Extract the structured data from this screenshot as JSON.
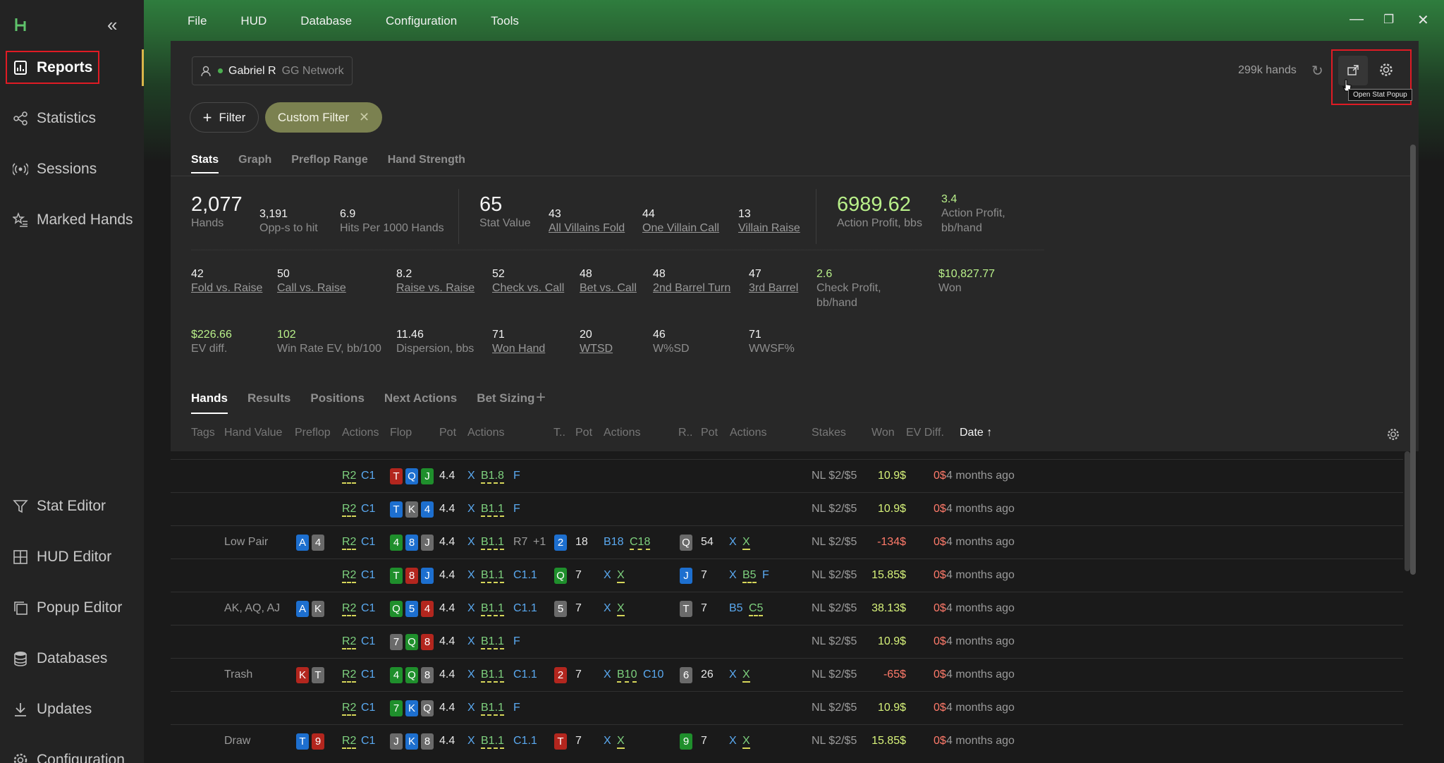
{
  "sidebar": {
    "items": [
      {
        "label": "Reports",
        "icon": "bar-chart-icon",
        "active": true
      },
      {
        "label": "Statistics",
        "icon": "share-nodes-icon"
      },
      {
        "label": "Sessions",
        "icon": "broadcast-icon"
      },
      {
        "label": "Marked Hands",
        "icon": "star-list-icon"
      },
      {
        "label": "Stat Editor",
        "icon": "funnel-icon"
      },
      {
        "label": "HUD Editor",
        "icon": "grid-add-icon"
      },
      {
        "label": "Popup Editor",
        "icon": "copy-icon"
      },
      {
        "label": "Databases",
        "icon": "database-icon"
      },
      {
        "label": "Updates",
        "icon": "download-icon"
      },
      {
        "label": "Configuration",
        "icon": "gear-icon"
      }
    ]
  },
  "menu": [
    "File",
    "HUD",
    "Database",
    "Configuration",
    "Tools"
  ],
  "header": {
    "player": "Gabriel R",
    "network": "GG Network",
    "hands_count": "299k hands",
    "tooltip": "Open Stat Popup"
  },
  "filters": {
    "filter_label": "Filter",
    "custom_label": "Custom Filter"
  },
  "stat_tabs": [
    "Stats",
    "Graph",
    "Preflop Range",
    "Hand Strength"
  ],
  "stats": {
    "hands": {
      "v": "2,077",
      "l": "Hands"
    },
    "opps": {
      "v": "3,191",
      "l": "Opp-s to hit"
    },
    "hits": {
      "v": "6.9",
      "l": "Hits Per 1000 Hands"
    },
    "stat_value": {
      "v": "65",
      "l": "Stat Value"
    },
    "all_fold": {
      "v": "43",
      "l": "All Villains Fold"
    },
    "one_call": {
      "v": "44",
      "l": "One Villain Call"
    },
    "v_raise": {
      "v": "13",
      "l": "Villain Raise"
    },
    "action_profit": {
      "v": "6989.62",
      "l": "Action Profit, bbs"
    },
    "action_profit_hand": {
      "v": "3.4",
      "l1": "Action Profit,",
      "l2": "bb/hand"
    },
    "fold_raise": {
      "v": "42",
      "l": "Fold vs. Raise"
    },
    "call_raise": {
      "v": "50",
      "l": "Call vs. Raise"
    },
    "raise_raise": {
      "v": "8.2",
      "l": "Raise vs. Raise"
    },
    "check_call": {
      "v": "52",
      "l": "Check vs. Call"
    },
    "bet_call": {
      "v": "48",
      "l": "Bet vs. Call"
    },
    "barrel2": {
      "v": "48",
      "l": "2nd Barrel Turn"
    },
    "barrel3": {
      "v": "47",
      "l": "3rd Barrel"
    },
    "check_profit": {
      "v": "2.6",
      "l1": "Check Profit,",
      "l2": "bb/hand"
    },
    "won": {
      "v": "$10,827.77",
      "l": "Won"
    },
    "ev_diff": {
      "v": "$226.66",
      "l": "EV diff."
    },
    "win_rate": {
      "v": "102",
      "l": "Win Rate EV, bb/100"
    },
    "dispersion": {
      "v": "11.46",
      "l": "Dispersion, bbs"
    },
    "won_hand": {
      "v": "71",
      "l": "Won Hand"
    },
    "wtsd": {
      "v": "20",
      "l": "WTSD"
    },
    "wsd": {
      "v": "46",
      "l": "W%SD"
    },
    "wwsf": {
      "v": "71",
      "l": "WWSF%"
    }
  },
  "hand_tabs": [
    "Hands",
    "Results",
    "Positions",
    "Next Actions",
    "Bet Sizing"
  ],
  "columns": [
    "Tags",
    "Hand Value",
    "Preflop",
    "Actions",
    "Flop",
    "Pot",
    "Actions",
    "T..",
    "Pot",
    "Actions",
    "R..",
    "Pot",
    "Actions",
    "Stakes",
    "Won",
    "EV Diff.",
    "Date ↑"
  ],
  "rows": [
    {
      "hv": "",
      "hole": [],
      "pre": [
        "R2",
        "C1"
      ],
      "flop": [
        [
          "T",
          "r"
        ],
        [
          "Q",
          "b"
        ],
        [
          "J",
          "g"
        ]
      ],
      "fpot": "4.4",
      "fact": [
        "X",
        "B1.8",
        "F"
      ],
      "turn": null,
      "tpot": "",
      "tact": [],
      "river": null,
      "rpot": "",
      "ract": [],
      "stakes": "NL $2/$5",
      "won": "10.9$",
      "ev": "0$",
      "date": "4 months ago"
    },
    {
      "hv": "",
      "hole": [],
      "pre": [
        "R2",
        "C1"
      ],
      "flop": [
        [
          "T",
          "b"
        ],
        [
          "K",
          "x"
        ],
        [
          "4",
          "b"
        ]
      ],
      "fpot": "4.4",
      "fact": [
        "X",
        "B1.1",
        "F"
      ],
      "turn": null,
      "tpot": "",
      "tact": [],
      "river": null,
      "rpot": "",
      "ract": [],
      "stakes": "NL $2/$5",
      "won": "10.9$",
      "ev": "0$",
      "date": "4 months ago"
    },
    {
      "hv": "Low Pair",
      "hole": [
        [
          "A",
          "b"
        ],
        [
          "4",
          "x"
        ]
      ],
      "pre": [
        "R2",
        "C1"
      ],
      "flop": [
        [
          "4",
          "g"
        ],
        [
          "8",
          "b"
        ],
        [
          "J",
          "x"
        ]
      ],
      "fpot": "4.4",
      "fact": [
        "X",
        "B1.1",
        "R7",
        "+1"
      ],
      "turn": [
        "2",
        "b"
      ],
      "tpot": "18",
      "tact": [
        "B18",
        "C18"
      ],
      "river": [
        "Q",
        "x"
      ],
      "rpot": "54",
      "ract": [
        "X",
        "X"
      ],
      "stakes": "NL $2/$5",
      "won": "-134$",
      "ev": "0$",
      "date": "4 months ago"
    },
    {
      "hv": "",
      "hole": [],
      "pre": [
        "R2",
        "C1"
      ],
      "flop": [
        [
          "T",
          "g"
        ],
        [
          "8",
          "r"
        ],
        [
          "J",
          "b"
        ]
      ],
      "fpot": "4.4",
      "fact": [
        "X",
        "B1.1",
        "C1.1"
      ],
      "turn": [
        "Q",
        "g"
      ],
      "tpot": "7",
      "tact": [
        "X",
        "X"
      ],
      "river": [
        "J",
        "b"
      ],
      "rpot": "7",
      "ract": [
        "X",
        "B5",
        "F"
      ],
      "stakes": "NL $2/$5",
      "won": "15.85$",
      "ev": "0$",
      "date": "4 months ago"
    },
    {
      "hv": "AK, AQ, AJ",
      "hole": [
        [
          "A",
          "b"
        ],
        [
          "K",
          "x"
        ]
      ],
      "pre": [
        "R2",
        "C1"
      ],
      "flop": [
        [
          "Q",
          "g"
        ],
        [
          "5",
          "b"
        ],
        [
          "4",
          "r"
        ]
      ],
      "fpot": "4.4",
      "fact": [
        "X",
        "B1.1",
        "C1.1"
      ],
      "turn": [
        "5",
        "x"
      ],
      "tpot": "7",
      "tact": [
        "X",
        "X"
      ],
      "river": [
        "T",
        "x"
      ],
      "rpot": "7",
      "ract": [
        "B5",
        "C5"
      ],
      "stakes": "NL $2/$5",
      "won": "38.13$",
      "ev": "0$",
      "date": "4 months ago"
    },
    {
      "hv": "",
      "hole": [],
      "pre": [
        "R2",
        "C1"
      ],
      "flop": [
        [
          "7",
          "x"
        ],
        [
          "Q",
          "g"
        ],
        [
          "8",
          "r"
        ]
      ],
      "fpot": "4.4",
      "fact": [
        "X",
        "B1.1",
        "F"
      ],
      "turn": null,
      "tpot": "",
      "tact": [],
      "river": null,
      "rpot": "",
      "ract": [],
      "stakes": "NL $2/$5",
      "won": "10.9$",
      "ev": "0$",
      "date": "4 months ago"
    },
    {
      "hv": "Trash",
      "hole": [
        [
          "K",
          "r"
        ],
        [
          "T",
          "x"
        ]
      ],
      "pre": [
        "R2",
        "C1"
      ],
      "flop": [
        [
          "4",
          "g"
        ],
        [
          "Q",
          "g"
        ],
        [
          "8",
          "x"
        ]
      ],
      "fpot": "4.4",
      "fact": [
        "X",
        "B1.1",
        "C1.1"
      ],
      "turn": [
        "2",
        "r"
      ],
      "tpot": "7",
      "tact": [
        "X",
        "B10",
        "C10"
      ],
      "river": [
        "6",
        "x"
      ],
      "rpot": "26",
      "ract": [
        "X",
        "X"
      ],
      "stakes": "NL $2/$5",
      "won": "-65$",
      "ev": "0$",
      "date": "4 months ago"
    },
    {
      "hv": "",
      "hole": [],
      "pre": [
        "R2",
        "C1"
      ],
      "flop": [
        [
          "7",
          "g"
        ],
        [
          "K",
          "b"
        ],
        [
          "Q",
          "x"
        ]
      ],
      "fpot": "4.4",
      "fact": [
        "X",
        "B1.1",
        "F"
      ],
      "turn": null,
      "tpot": "",
      "tact": [],
      "river": null,
      "rpot": "",
      "ract": [],
      "stakes": "NL $2/$5",
      "won": "10.9$",
      "ev": "0$",
      "date": "4 months ago"
    },
    {
      "hv": "Draw",
      "hole": [
        [
          "T",
          "b"
        ],
        [
          "9",
          "r"
        ]
      ],
      "pre": [
        "R2",
        "C1"
      ],
      "flop": [
        [
          "J",
          "x"
        ],
        [
          "K",
          "b"
        ],
        [
          "8",
          "x"
        ]
      ],
      "fpot": "4.4",
      "fact": [
        "X",
        "B1.1",
        "C1.1"
      ],
      "turn": [
        "T",
        "r"
      ],
      "tpot": "7",
      "tact": [
        "X",
        "X"
      ],
      "river": [
        "9",
        "g"
      ],
      "rpot": "7",
      "ract": [
        "X",
        "X"
      ],
      "stakes": "NL $2/$5",
      "won": "15.85$",
      "ev": "0$",
      "date": "4 months ago"
    }
  ],
  "colors": {
    "accent_green": "#b9f08a",
    "highlight_red": "#e01b24",
    "filter_olive": "#7b8150"
  }
}
